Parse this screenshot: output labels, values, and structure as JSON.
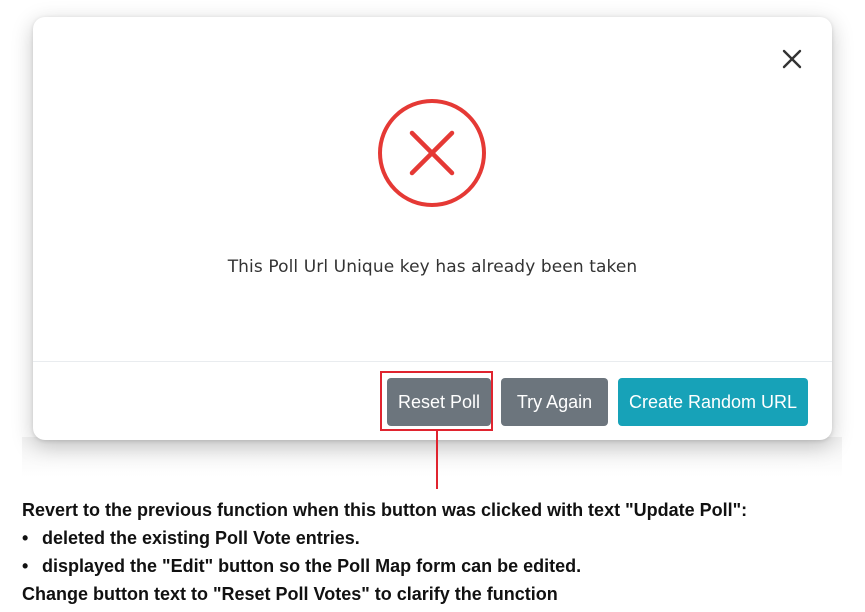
{
  "modal": {
    "message": "This Poll Url Unique key has already been taken",
    "close_icon": "close-icon",
    "status_icon": "error-circle-x-icon",
    "error_color": "#e53935",
    "buttons": {
      "reset": "Reset Poll",
      "try_again": "Try Again",
      "create_random": "Create Random URL"
    },
    "button_colors": {
      "secondary": "#6c757d",
      "info": "#17a2b8"
    }
  },
  "annotation": {
    "color": "#e0242f",
    "line1": "Revert to the previous function when this button was clicked with text \"Update Poll\":",
    "bullets": [
      "deleted the existing Poll Vote entries.",
      "displayed the \"Edit\" button so the Poll Map form can be edited."
    ],
    "line_last": "Change button text to \"Reset Poll Votes\" to clarify the function"
  }
}
